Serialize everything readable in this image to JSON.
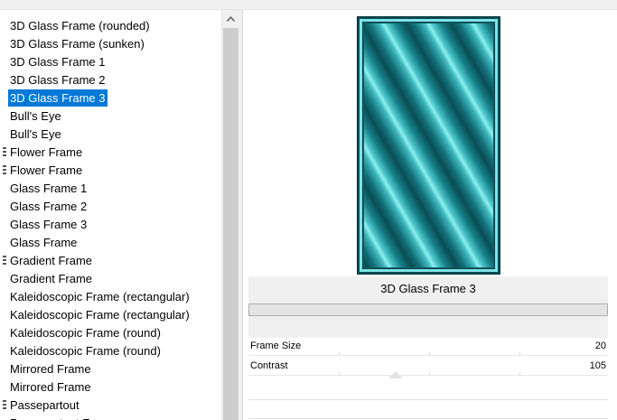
{
  "list": {
    "items": [
      {
        "label": "3D Glass Frame (rounded)",
        "selected": false,
        "group": false
      },
      {
        "label": "3D Glass Frame (sunken)",
        "selected": false,
        "group": false
      },
      {
        "label": "3D Glass Frame 1",
        "selected": false,
        "group": false
      },
      {
        "label": "3D Glass Frame 2",
        "selected": false,
        "group": false
      },
      {
        "label": "3D Glass Frame 3",
        "selected": true,
        "group": false
      },
      {
        "label": "Bull's Eye",
        "selected": false,
        "group": false
      },
      {
        "label": "Bull's Eye",
        "selected": false,
        "group": false
      },
      {
        "label": "Flower Frame",
        "selected": false,
        "group": true
      },
      {
        "label": "Flower Frame",
        "selected": false,
        "group": true
      },
      {
        "label": "Glass Frame 1",
        "selected": false,
        "group": false
      },
      {
        "label": "Glass Frame 2",
        "selected": false,
        "group": false
      },
      {
        "label": "Glass Frame 3",
        "selected": false,
        "group": false
      },
      {
        "label": "Glass Frame",
        "selected": false,
        "group": false
      },
      {
        "label": "Gradient Frame",
        "selected": false,
        "group": true
      },
      {
        "label": "Gradient Frame",
        "selected": false,
        "group": false
      },
      {
        "label": "Kaleidoscopic Frame (rectangular)",
        "selected": false,
        "group": false
      },
      {
        "label": "Kaleidoscopic Frame (rectangular)",
        "selected": false,
        "group": false
      },
      {
        "label": "Kaleidoscopic Frame (round)",
        "selected": false,
        "group": false
      },
      {
        "label": "Kaleidoscopic Frame (round)",
        "selected": false,
        "group": false
      },
      {
        "label": "Mirrored Frame",
        "selected": false,
        "group": false
      },
      {
        "label": "Mirrored Frame",
        "selected": false,
        "group": false
      },
      {
        "label": "Passepartout",
        "selected": false,
        "group": true
      },
      {
        "label": "Passepartout Frame",
        "selected": false,
        "group": false
      }
    ]
  },
  "scrollbar": {
    "up_icon": "chevron-up-icon"
  },
  "preview": {
    "caption": "3D Glass Frame 3",
    "colors": {
      "dark": "#0a4d55",
      "mid": "#1fa3a8",
      "light": "#7fe9ea"
    }
  },
  "params": {
    "frame_size": {
      "label": "Frame Size",
      "value": "20"
    },
    "contrast": {
      "label": "Contrast",
      "value": "105"
    }
  }
}
